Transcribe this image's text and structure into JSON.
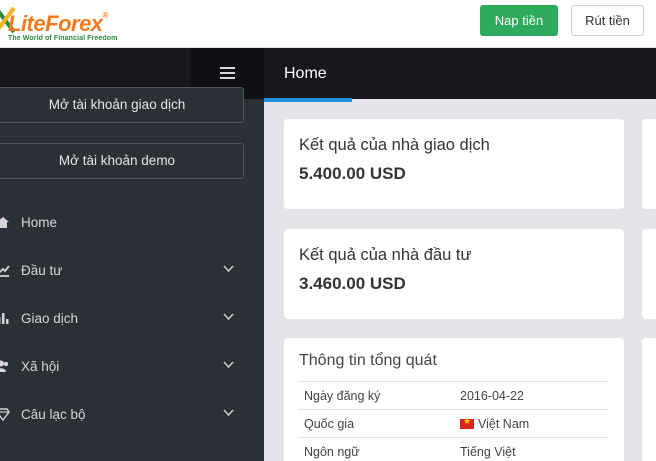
{
  "brand": {
    "name_part1": "Lite",
    "name_part2": "Forex",
    "tagline": "The World of Financial Freedom",
    "primary_color": "#f07a1e",
    "tagline_color": "#2a8a3a"
  },
  "header": {
    "deposit_label": "Nap tiền",
    "withdraw_label": "Rút tiền"
  },
  "sidebar": {
    "open_account_label": "Mở tài khoản giao dịch",
    "open_demo_label": "Mở tài khoản demo",
    "items": [
      {
        "label": "Home",
        "icon": "home-icon",
        "has_submenu": false
      },
      {
        "label": "Đầu tư",
        "icon": "chart-line-icon",
        "has_submenu": true
      },
      {
        "label": "Giao dịch",
        "icon": "bar-chart-icon",
        "has_submenu": true
      },
      {
        "label": "Xã hội",
        "icon": "users-icon",
        "has_submenu": true
      },
      {
        "label": "Câu lạc bộ",
        "icon": "diamond-icon",
        "has_submenu": true
      }
    ]
  },
  "page": {
    "title": "Home",
    "accent_color": "#1e8fd8"
  },
  "cards": {
    "trader_result_label": "Kết quả của nhà giao dịch",
    "trader_result_value": "5.400.00 USD",
    "investor_result_label": "Kết quả của nhà đầu tư",
    "investor_result_value": "3.460.00 USD"
  },
  "general_info": {
    "title": "Thông tin tổng quát",
    "rows": [
      {
        "label": "Ngày đăng ký",
        "value": "2016-04-22"
      },
      {
        "label": "Quốc gia",
        "value": "Việt Nam"
      },
      {
        "label": "Ngôn ngữ",
        "value": "Tiếng Việt"
      }
    ]
  }
}
